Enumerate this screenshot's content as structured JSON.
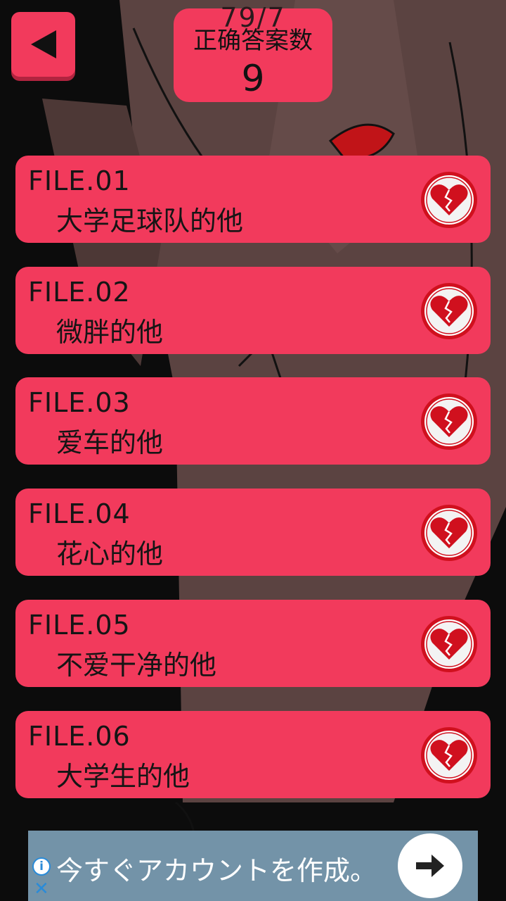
{
  "header": {
    "ghost_text": "79/7",
    "score_label": "正确答案数",
    "score_value": "9"
  },
  "files": [
    {
      "code": "FILE.01",
      "name": "大学足球队的他"
    },
    {
      "code": "FILE.02",
      "name": "微胖的他"
    },
    {
      "code": "FILE.03",
      "name": "爱车的他"
    },
    {
      "code": "FILE.04",
      "name": "花心的他"
    },
    {
      "code": "FILE.05",
      "name": "不爱干净的他"
    },
    {
      "code": "FILE.06",
      "name": "大学生的他"
    }
  ],
  "ad": {
    "text": "今すぐアカウントを作成。",
    "info_icon": "i",
    "close_icon": "✕"
  },
  "colors": {
    "card": "#f23a5c",
    "card_shadow": "#b1243f",
    "heart": "#d0101e",
    "ad_bg": "#7393a8"
  },
  "icons": {
    "back": "back-triangle-icon",
    "badge": "broken-heart-icon",
    "ad_arrow": "arrow-right-icon"
  }
}
